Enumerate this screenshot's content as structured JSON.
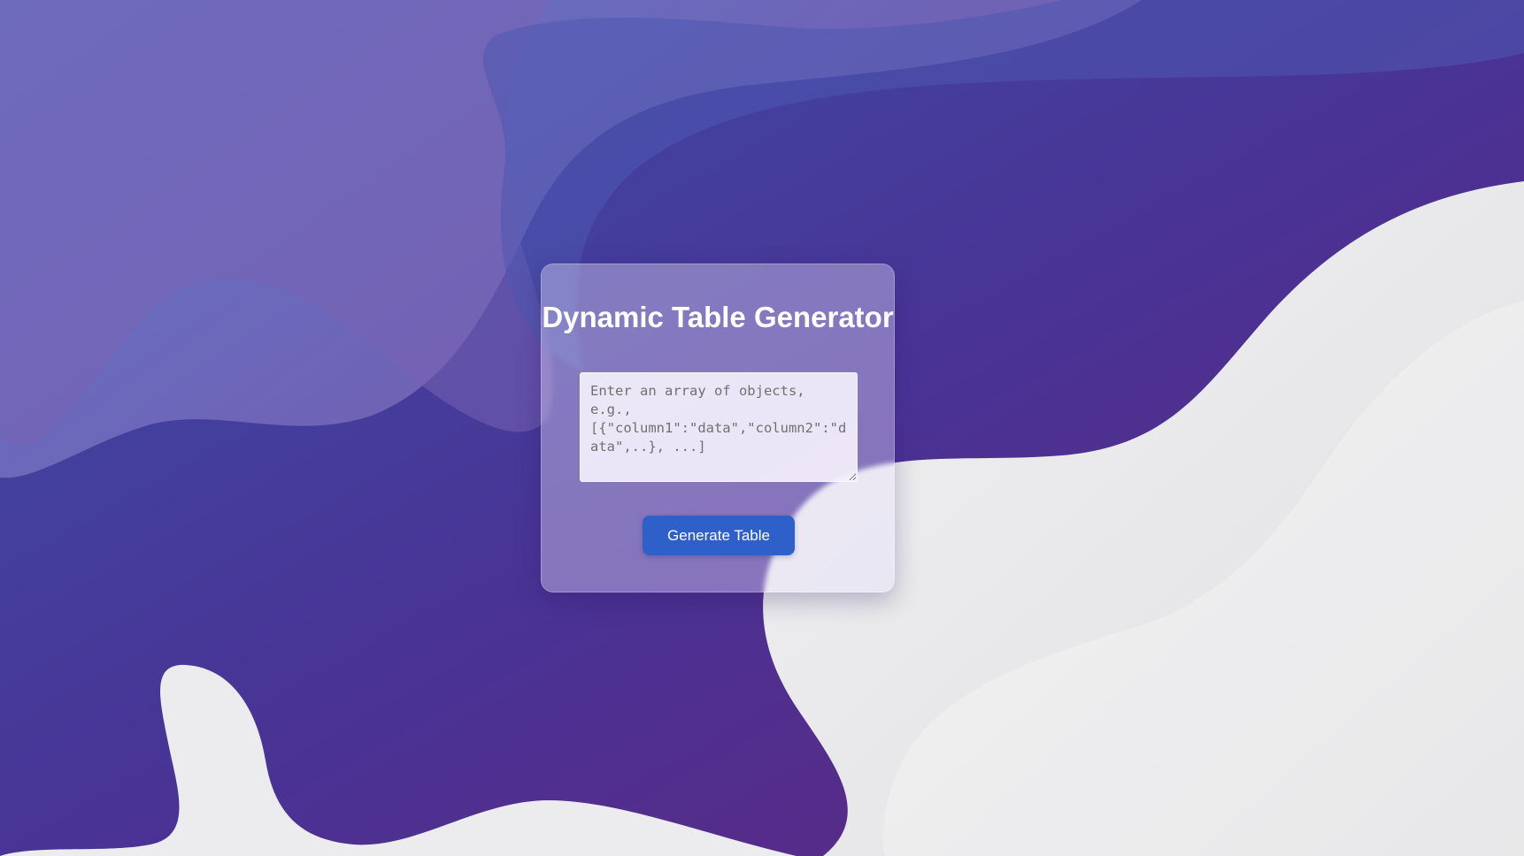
{
  "page": {
    "title": "Dynamic Table Generator"
  },
  "form": {
    "input_placeholder": "Enter an array of objects, e.g., [{\"column1\":\"data\",\"column2\":\"data\",..}, ...]",
    "input_value": "",
    "button_label": "Generate Table"
  },
  "colors": {
    "bg_blue": "#3a4ba5",
    "bg_purple": "#5a2a8a",
    "bg_light": "#e8e8ea",
    "button": "#2f5fc9"
  }
}
